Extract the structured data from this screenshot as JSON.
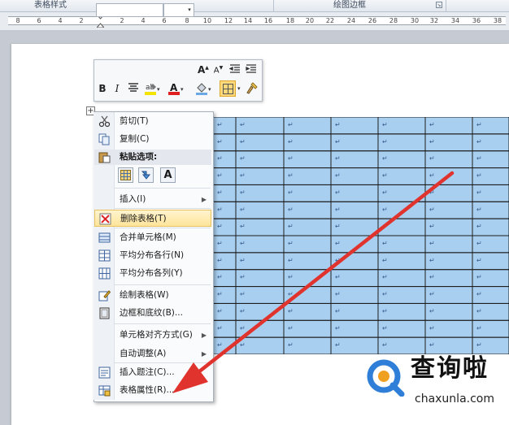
{
  "ribbon": {
    "group_left": "表格样式",
    "group_right": "绘图边框"
  },
  "ruler": {
    "numbers": [
      "8",
      "6",
      "4",
      "2",
      "2",
      "4",
      "6",
      "8",
      "10",
      "12",
      "14",
      "16",
      "18",
      "20",
      "22",
      "24",
      "26",
      "28",
      "30",
      "32",
      "34",
      "36",
      "38"
    ]
  },
  "mini_toolbar": {
    "font_name_value": "",
    "font_size_value": "",
    "grow_font": "A",
    "shrink_font": "A",
    "bold": "B",
    "italic": "I",
    "font_color": "A"
  },
  "table": {
    "rows": 14,
    "cols": 6,
    "cell_mark": "↵",
    "fill_color": "#a8cff0",
    "border_color": "#1c1c1c"
  },
  "context_menu": {
    "cut": "剪切(T)",
    "copy": "复制(C)",
    "paste_options": "粘贴选项:",
    "paste_text_icon": "A",
    "insert": "插入(I)",
    "delete_table": "删除表格(T)",
    "merge_cells": "合并单元格(M)",
    "distribute_rows": "平均分布各行(N)",
    "distribute_cols": "平均分布各列(Y)",
    "draw_table": "绘制表格(W)",
    "borders_shading": "边框和底纹(B)...",
    "cell_alignment": "单元格对齐方式(G)",
    "autofit": "自动调整(A)",
    "insert_caption": "插入题注(C)...",
    "table_properties": "表格属性(R)..."
  },
  "watermark": {
    "brand": "查询啦",
    "url": "chaxunla.com",
    "logo_color": "#2f7fd8"
  },
  "annotation": {
    "arrow_color": "#e0332e"
  }
}
